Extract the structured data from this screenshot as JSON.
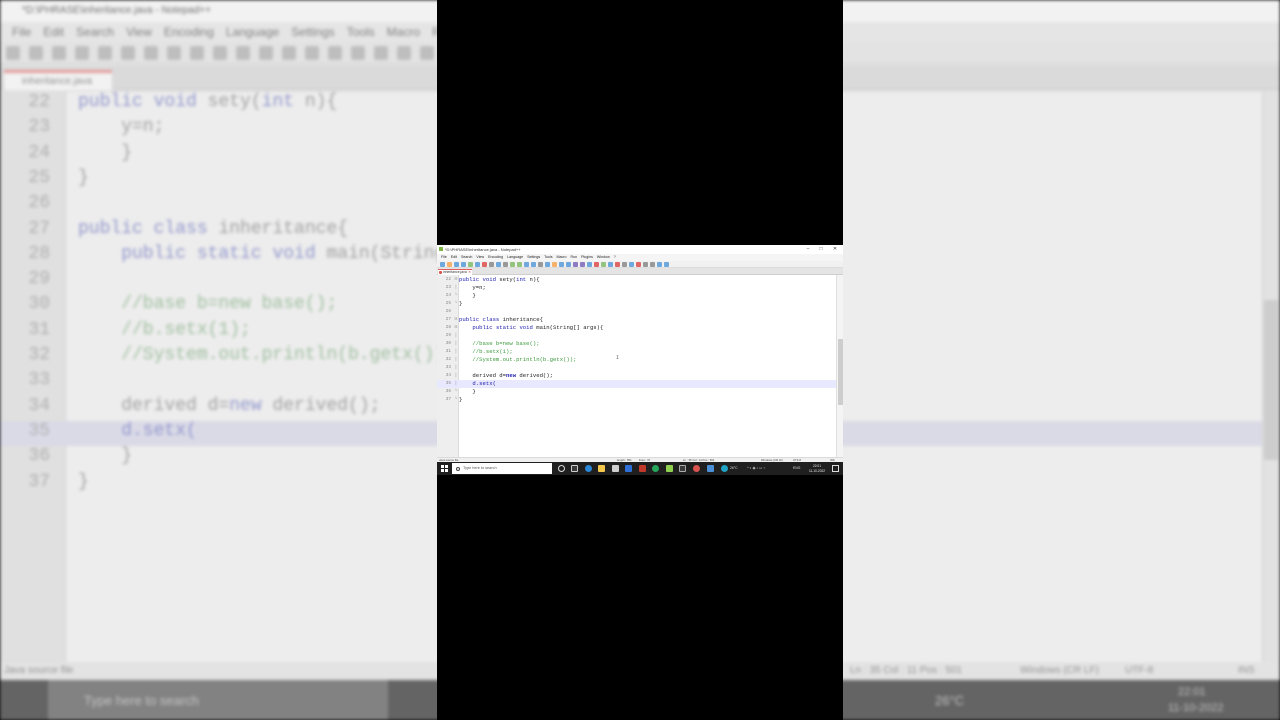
{
  "window": {
    "title": "*D:\\PHRASE\\inheritance.java - Notepad++",
    "buttons": {
      "minimize": "–",
      "maximize": "□",
      "close": "✕"
    }
  },
  "menu": [
    "File",
    "Edit",
    "Search",
    "View",
    "Encoding",
    "Language",
    "Settings",
    "Tools",
    "Macro",
    "Run",
    "Plugins",
    "Window",
    "?"
  ],
  "tab": {
    "label": "inheritance.java",
    "close": "✕"
  },
  "editor": {
    "lines": [
      {
        "num": "22",
        "fold": "⊟",
        "segments": [
          {
            "text": "public ",
            "style": "kw"
          },
          {
            "text": "void ",
            "style": "kw"
          },
          {
            "text": "sety(",
            "style": ""
          },
          {
            "text": "int ",
            "style": "kw"
          },
          {
            "text": "n){",
            "style": ""
          }
        ]
      },
      {
        "num": "23",
        "fold": "│",
        "segments": [
          {
            "text": "    y=n;",
            "style": ""
          }
        ]
      },
      {
        "num": "24",
        "fold": "└",
        "segments": [
          {
            "text": "    }",
            "style": ""
          }
        ]
      },
      {
        "num": "25",
        "fold": "└",
        "segments": [
          {
            "text": "}",
            "style": ""
          }
        ]
      },
      {
        "num": "26",
        "fold": "",
        "segments": [
          {
            "text": "",
            "style": ""
          }
        ]
      },
      {
        "num": "27",
        "fold": "⊟",
        "segments": [
          {
            "text": "public ",
            "style": "kw"
          },
          {
            "text": "class ",
            "style": "kw"
          },
          {
            "text": "inheritance{",
            "style": ""
          }
        ]
      },
      {
        "num": "28",
        "fold": "⊟",
        "segments": [
          {
            "text": "    public ",
            "style": "kw"
          },
          {
            "text": "static ",
            "style": "kw"
          },
          {
            "text": "void ",
            "style": "kw"
          },
          {
            "text": "main(String[] args){",
            "style": ""
          }
        ]
      },
      {
        "num": "29",
        "fold": "│",
        "segments": [
          {
            "text": "",
            "style": ""
          }
        ]
      },
      {
        "num": "30",
        "fold": "│",
        "segments": [
          {
            "text": "    //base b=new base();",
            "style": "cm"
          }
        ]
      },
      {
        "num": "31",
        "fold": "│",
        "segments": [
          {
            "text": "    //b.setx(1);",
            "style": "cm"
          }
        ]
      },
      {
        "num": "32",
        "fold": "│",
        "segments": [
          {
            "text": "    //System.out.println(b.getx());",
            "style": "cm"
          }
        ]
      },
      {
        "num": "33",
        "fold": "│",
        "segments": [
          {
            "text": "",
            "style": ""
          }
        ]
      },
      {
        "num": "34",
        "fold": "│",
        "segments": [
          {
            "text": "    derived d=",
            "style": ""
          },
          {
            "text": "new",
            "style": "kwb"
          },
          {
            "text": " derived();",
            "style": ""
          }
        ]
      },
      {
        "num": "35",
        "fold": "│",
        "current": true,
        "segments": [
          {
            "text": "    d.setx(",
            "style": "kw"
          }
        ]
      },
      {
        "num": "36",
        "fold": "└",
        "segments": [
          {
            "text": "    }",
            "style": ""
          }
        ]
      },
      {
        "num": "37",
        "fold": "└",
        "segments": [
          {
            "text": "}",
            "style": ""
          }
        ]
      }
    ]
  },
  "status": {
    "file_type": "Java source file",
    "length": "length : 551",
    "lines": "lines : 37",
    "position": "Ln : 35   Col : 11   Pos : 501",
    "eol": "Windows (CR LF)",
    "encoding": "UTF-8",
    "mode": "INS"
  },
  "taskbar": {
    "search_placeholder": "Type here to search",
    "weather": "26°C",
    "lang": "ENG",
    "time": "22:01",
    "date": "11-10-2022"
  },
  "background": {
    "title": "*D:\\PHRASE\\inheritance.java - Notepad++",
    "menu": [
      "File",
      "Edit",
      "Search",
      "View",
      "Encoding",
      "Language",
      "Settings",
      "Tools",
      "Macro",
      "Run"
    ],
    "tab_label": "inheritance.java",
    "status_left": "Java source file",
    "status_pos": "Ln : 35   Col : 11   Pos : 501",
    "status_eol": "Windows (CR LF)",
    "status_enc": "UTF-8",
    "status_mode": "INS",
    "search_placeholder": "Type here to search",
    "weather": "26°C",
    "time": "22:01",
    "date": "11-10-2022"
  },
  "colors": {
    "keyword": "#1a1ab0",
    "comment": "#3c9a3c",
    "current_line": "#e8e8ff",
    "tab_accent": "#e35d5d",
    "taskbar": "#1f1f1f"
  }
}
